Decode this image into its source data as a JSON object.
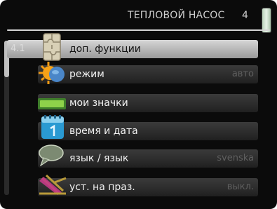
{
  "header": {
    "title": "ТЕПЛОВОЙ НАСОС",
    "menu_number": "4"
  },
  "selected_item_code": "4.1",
  "menu": [
    {
      "label": "доп. функции",
      "value": "",
      "icon": "puzzle-icon"
    },
    {
      "label": "режим",
      "value": "авто",
      "icon": "sun-planet-icon"
    },
    {
      "label": "мои значки",
      "value": "",
      "icon": "battery-icon"
    },
    {
      "label": "время и дата",
      "value": "",
      "icon": "calendar-icon"
    },
    {
      "label": "язык / язык",
      "value": "svenska",
      "icon": "speech-bubble-icon"
    },
    {
      "label": "уст. на праз.",
      "value": "выкл.",
      "icon": "beach-chair-icon"
    }
  ],
  "colors": {
    "background": "#0b0b0b",
    "selected_row": "#c8c8c8",
    "row": "#2e2e2e",
    "text": "#f2f2f2",
    "muted_value": "#5f5f5f"
  }
}
